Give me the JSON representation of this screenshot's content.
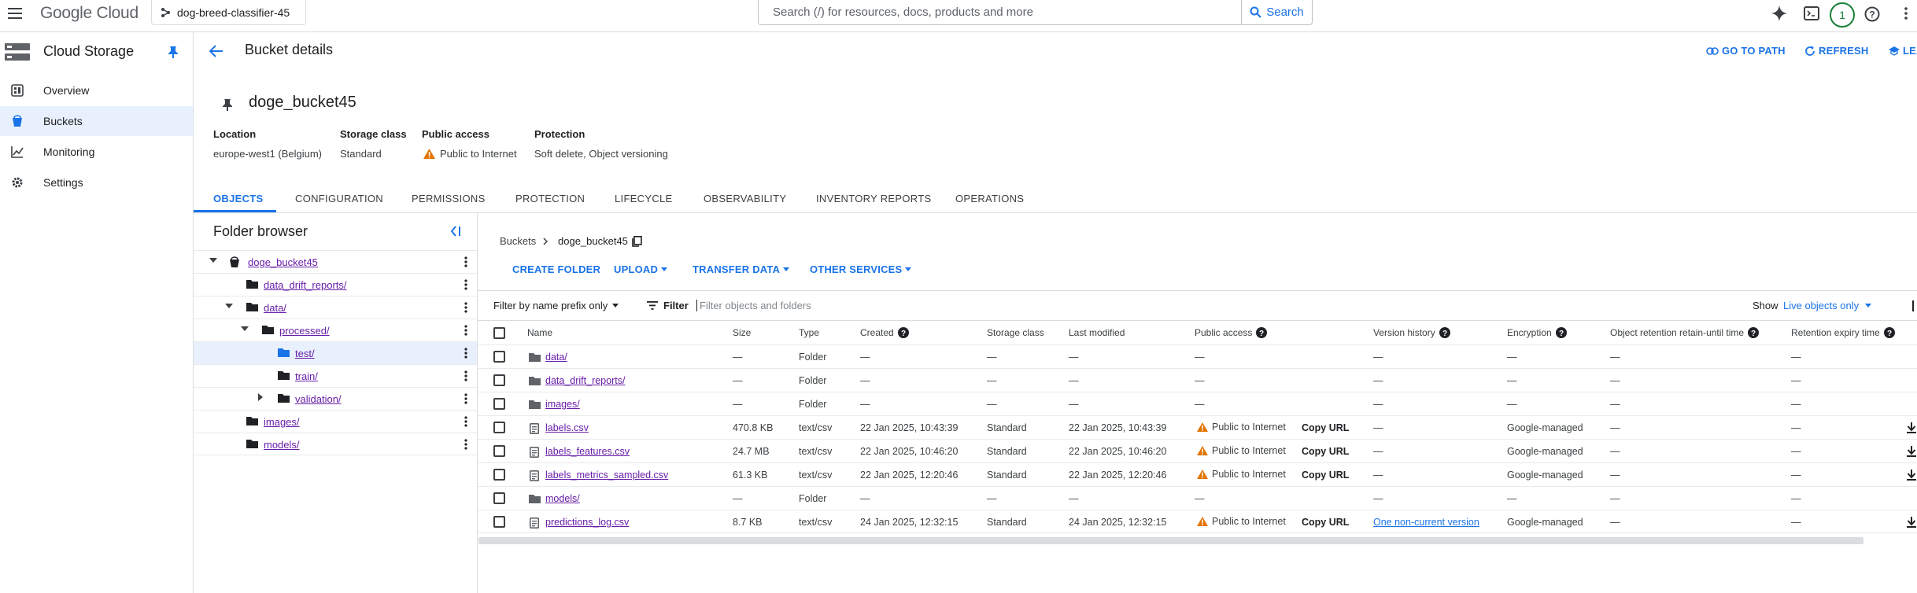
{
  "topbar": {
    "brand": "Google Cloud",
    "project": "dog-breed-classifier-45",
    "search_placeholder": "Search (/) for resources, docs, products and more",
    "search_button": "Search",
    "notifications_count": "1"
  },
  "sidebar": {
    "title": "Cloud Storage",
    "items": [
      {
        "label": "Overview",
        "icon": "dashboard-icon"
      },
      {
        "label": "Buckets",
        "icon": "bucket-icon"
      },
      {
        "label": "Monitoring",
        "icon": "chart-icon"
      },
      {
        "label": "Settings",
        "icon": "gear-icon"
      }
    ]
  },
  "header": {
    "title": "Bucket details",
    "go_to_path": "GO TO PATH",
    "refresh": "REFRESH",
    "learn": "LEA"
  },
  "bucket": {
    "name": "doge_bucket45",
    "location_label": "Location",
    "location": "europe-west1 (Belgium)",
    "storage_class_label": "Storage class",
    "storage_class": "Standard",
    "public_access_label": "Public access",
    "public_access": "Public to Internet",
    "protection_label": "Protection",
    "protection": "Soft delete, Object versioning"
  },
  "tabs": [
    "OBJECTS",
    "CONFIGURATION",
    "PERMISSIONS",
    "PROTECTION",
    "LIFECYCLE",
    "OBSERVABILITY",
    "INVENTORY REPORTS",
    "OPERATIONS"
  ],
  "folder_browser": {
    "title": "Folder browser",
    "items": [
      {
        "label": "doge_bucket45"
      },
      {
        "label": "data_drift_reports/"
      },
      {
        "label": "data/"
      },
      {
        "label": "processed/"
      },
      {
        "label": "test/"
      },
      {
        "label": "train/"
      },
      {
        "label": "validation/"
      },
      {
        "label": "images/"
      },
      {
        "label": "models/"
      }
    ]
  },
  "breadcrumb": {
    "root": "Buckets",
    "current": "doge_bucket45"
  },
  "toolbar": {
    "create_folder": "CREATE FOLDER",
    "upload": "UPLOAD",
    "transfer_data": "TRANSFER DATA",
    "other_services": "OTHER SERVICES"
  },
  "filterbar": {
    "prefix_filter": "Filter by name prefix only",
    "filter_label": "Filter",
    "filter_placeholder": "Filter objects and folders",
    "show_label": "Show",
    "show_value": "Live objects only"
  },
  "table": {
    "columns": [
      "Name",
      "Size",
      "Type",
      "Created",
      "Storage class",
      "Last modified",
      "Public access",
      "Version history",
      "Encryption",
      "Object retention retain-until time",
      "Retention expiry time"
    ],
    "copy_url": "Copy URL",
    "rows": [
      {
        "name": "data/",
        "size": "—",
        "type": "Folder",
        "created": "—",
        "storage_class": "—",
        "last_modified": "—",
        "public_access": "—",
        "version_history": "—",
        "encryption": "—",
        "retain_until": "—",
        "expiry": "—"
      },
      {
        "name": "data_drift_reports/",
        "size": "—",
        "type": "Folder",
        "created": "—",
        "storage_class": "—",
        "last_modified": "—",
        "public_access": "—",
        "version_history": "—",
        "encryption": "—",
        "retain_until": "—",
        "expiry": "—"
      },
      {
        "name": "images/",
        "size": "—",
        "type": "Folder",
        "created": "—",
        "storage_class": "—",
        "last_modified": "—",
        "public_access": "—",
        "version_history": "—",
        "encryption": "—",
        "retain_until": "—",
        "expiry": "—"
      },
      {
        "name": "labels.csv",
        "size": "470.8 KB",
        "type": "text/csv",
        "created": "22 Jan 2025, 10:43:39",
        "storage_class": "Standard",
        "last_modified": "22 Jan 2025, 10:43:39",
        "public_access": "Public to Internet",
        "version_history": "—",
        "encryption": "Google-managed",
        "retain_until": "—",
        "expiry": "—"
      },
      {
        "name": "labels_features.csv",
        "size": "24.7 MB",
        "type": "text/csv",
        "created": "22 Jan 2025, 10:46:20",
        "storage_class": "Standard",
        "last_modified": "22 Jan 2025, 10:46:20",
        "public_access": "Public to Internet",
        "version_history": "—",
        "encryption": "Google-managed",
        "retain_until": "—",
        "expiry": "—"
      },
      {
        "name": "labels_metrics_sampled.csv",
        "size": "61.3 KB",
        "type": "text/csv",
        "created": "22 Jan 2025, 12:20:46",
        "storage_class": "Standard",
        "last_modified": "22 Jan 2025, 12:20:46",
        "public_access": "Public to Internet",
        "version_history": "—",
        "encryption": "Google-managed",
        "retain_until": "—",
        "expiry": "—"
      },
      {
        "name": "models/",
        "size": "—",
        "type": "Folder",
        "created": "—",
        "storage_class": "—",
        "last_modified": "—",
        "public_access": "—",
        "version_history": "—",
        "encryption": "—",
        "retain_until": "—",
        "expiry": "—"
      },
      {
        "name": "predictions_log.csv",
        "size": "8.7 KB",
        "type": "text/csv",
        "created": "24 Jan 2025, 12:32:15",
        "storage_class": "Standard",
        "last_modified": "24 Jan 2025, 12:32:15",
        "public_access": "Public to Internet",
        "version_history": "One non-current version",
        "encryption": "Google-managed",
        "retain_until": "—",
        "expiry": "—"
      }
    ]
  },
  "colors": {
    "accent": "#1a73e8",
    "visited": "#681da8",
    "warning": "#e37400",
    "selected_bg": "#e8f0fe"
  }
}
